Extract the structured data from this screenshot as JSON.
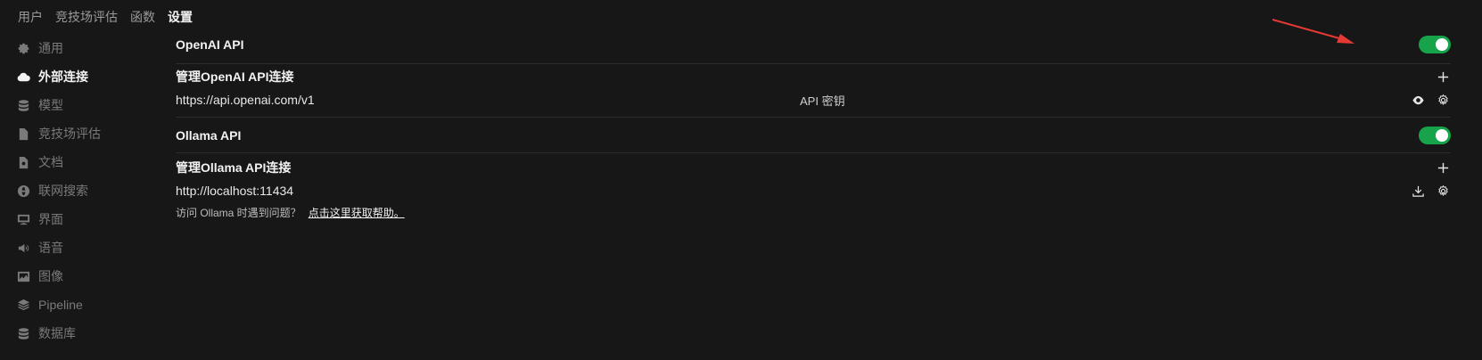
{
  "top_tabs": [
    {
      "label": "用户"
    },
    {
      "label": "竞技场评估"
    },
    {
      "label": "函数"
    },
    {
      "label": "设置"
    }
  ],
  "sidebar": {
    "items": [
      {
        "label": "通用",
        "icon": "gear-icon"
      },
      {
        "label": "外部连接",
        "icon": "cloud-icon"
      },
      {
        "label": "模型",
        "icon": "database-icon"
      },
      {
        "label": "竞技场评估",
        "icon": "document-icon"
      },
      {
        "label": "文档",
        "icon": "file-icon"
      },
      {
        "label": "联网搜索",
        "icon": "globe-icon"
      },
      {
        "label": "界面",
        "icon": "monitor-icon"
      },
      {
        "label": "语音",
        "icon": "speaker-icon"
      },
      {
        "label": "图像",
        "icon": "image-icon"
      },
      {
        "label": "Pipeline",
        "icon": "layers-icon"
      },
      {
        "label": "数据库",
        "icon": "database-icon"
      }
    ],
    "active_index": 1
  },
  "openai": {
    "title": "OpenAI API",
    "enabled": true,
    "manage_title": "管理OpenAI API连接",
    "url": "https://api.openai.com/v1",
    "api_key_label": "API 密钥"
  },
  "ollama": {
    "title": "Ollama API",
    "enabled": true,
    "manage_title": "管理Ollama API连接",
    "url": "http://localhost:11434",
    "help_text": "访问 Ollama 时遇到问题？",
    "help_link": "点击这里获取帮助。"
  },
  "colors": {
    "background": "#171717",
    "toggle_on": "#16a34a",
    "annotation_arrow": "#e53935"
  }
}
